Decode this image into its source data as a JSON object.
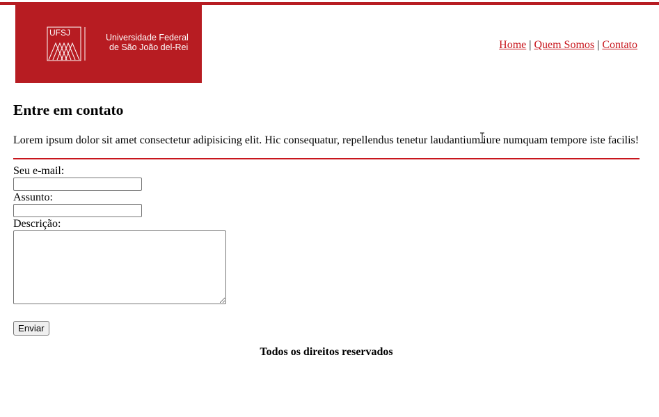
{
  "header": {
    "logo_abbr": "UFSJ",
    "logo_line1": "Universidade Federal",
    "logo_line2": "de São João del-Rei",
    "brand_color": "#b71c22",
    "nav": {
      "home": "Home",
      "sep1": "|",
      "quem_somos": "Quem Somos",
      "sep2": "|",
      "contato": "Contato"
    }
  },
  "main": {
    "heading": "Entre em contato",
    "intro": "Lorem ipsum dolor sit amet consectetur adipisicing elit. Hic consequatur, repellendus tenetur laudantium iure numquam tempore iste facilis!"
  },
  "form": {
    "email_label": "Seu e-mail:",
    "email_value": "",
    "subject_label": "Assunto:",
    "subject_value": "",
    "description_label": "Descrição:",
    "description_value": "",
    "submit_label": "Enviar"
  },
  "footer": {
    "text": "Todos os direitos reservados"
  },
  "icons": {
    "cursor": "text-cursor-icon"
  }
}
